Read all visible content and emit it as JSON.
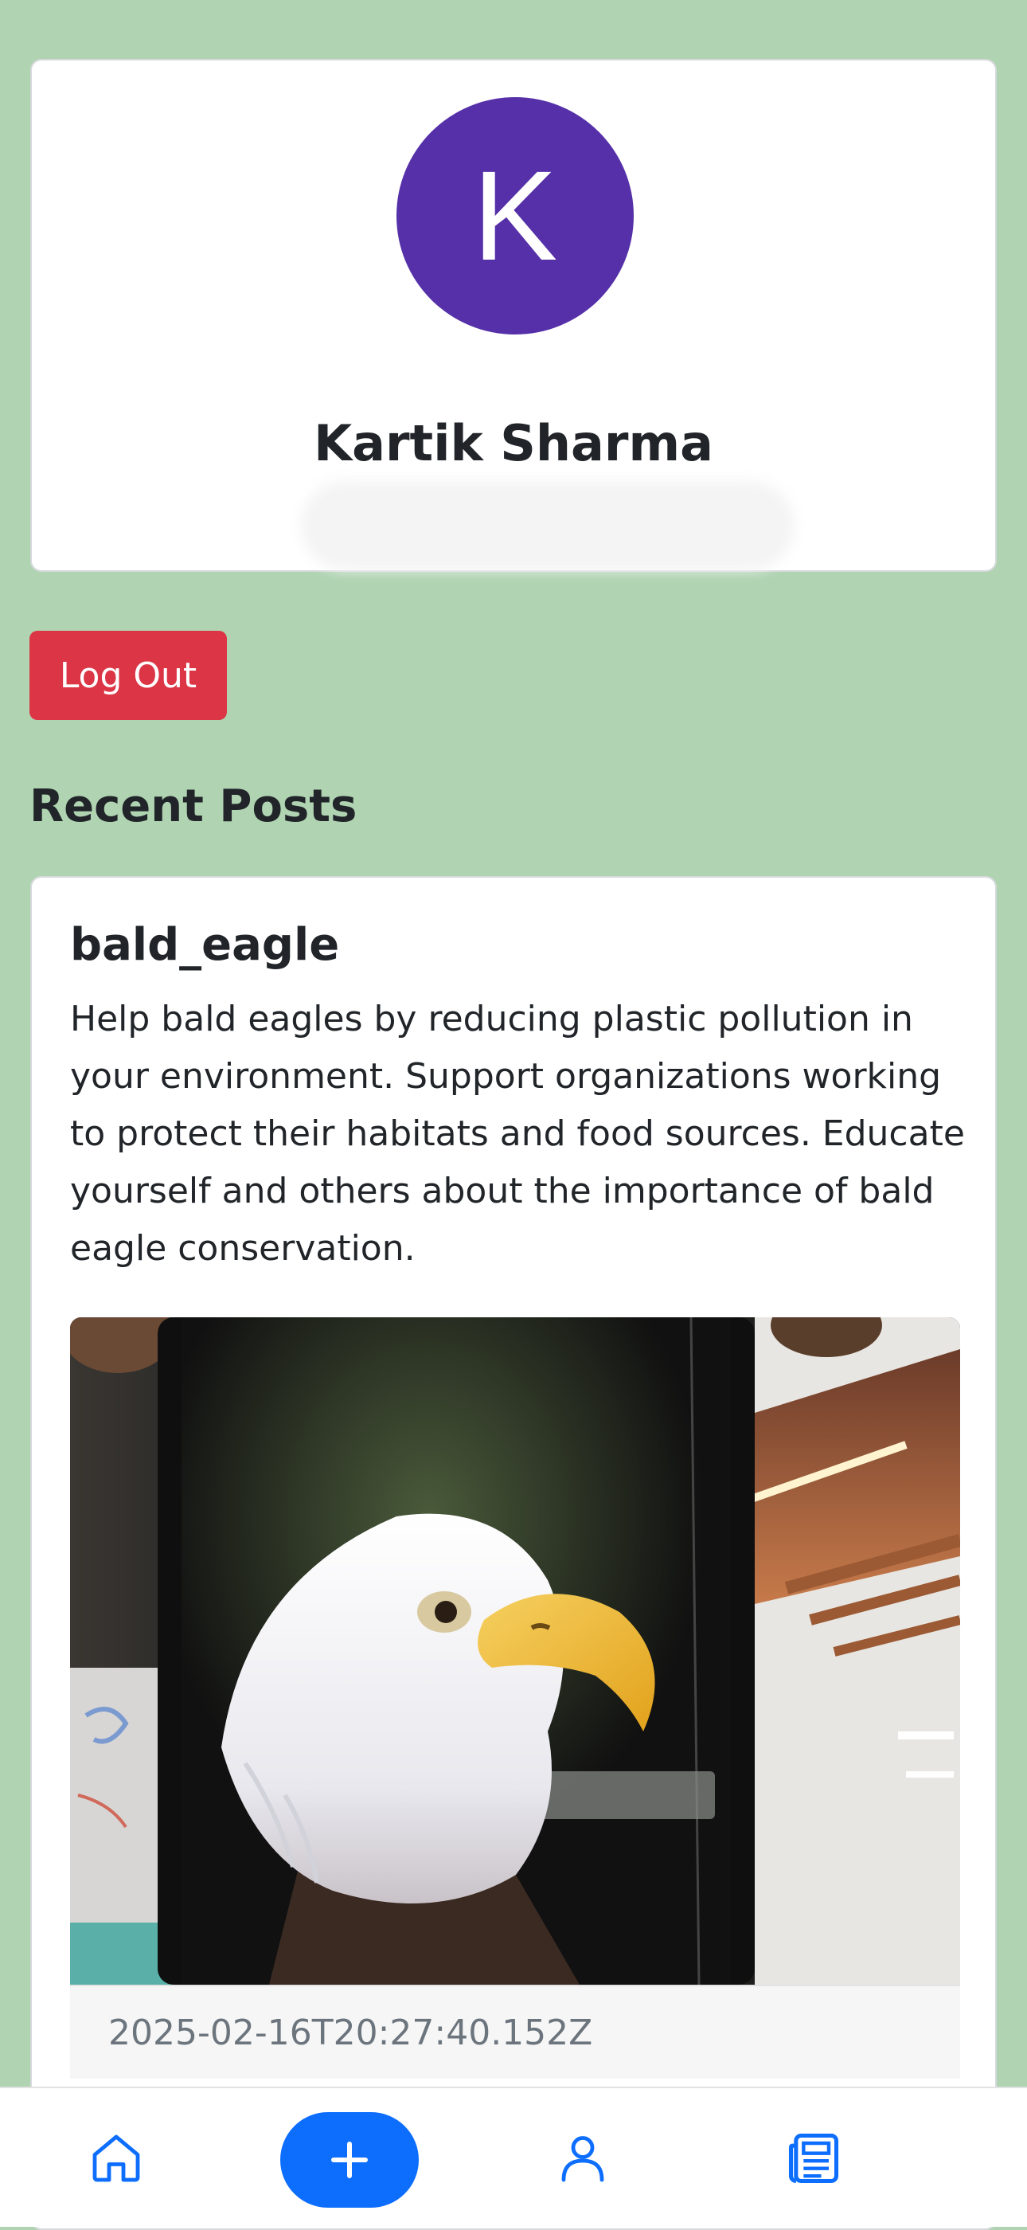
{
  "profile": {
    "avatar_initial": "K",
    "name": "Kartik Sharma"
  },
  "actions": {
    "logout_label": "Log Out"
  },
  "recent_posts": {
    "heading": "Recent Posts",
    "items": [
      {
        "title": "bald_eagle",
        "body": "Help bald eagles by reducing plastic pollution in your environment. Support organizations working to protect their habitats and food sources. Educate yourself and others about the importance of bald eagle conservation.",
        "image_description": "photo-of-phone-screen-showing-bald-eagle",
        "timestamp": "2025-02-16T20:27:40.152Z"
      }
    ]
  },
  "bottom_nav": {
    "items": [
      {
        "icon": "home-icon",
        "active": false
      },
      {
        "icon": "plus-icon",
        "primary": true
      },
      {
        "icon": "user-icon",
        "active": true
      },
      {
        "icon": "feed-icon",
        "active": false
      }
    ]
  },
  "colors": {
    "page_background": "#b0d4b2",
    "avatar_background": "#5530a8",
    "logout_background": "#dc3545",
    "accent_blue": "#0d6efd"
  }
}
